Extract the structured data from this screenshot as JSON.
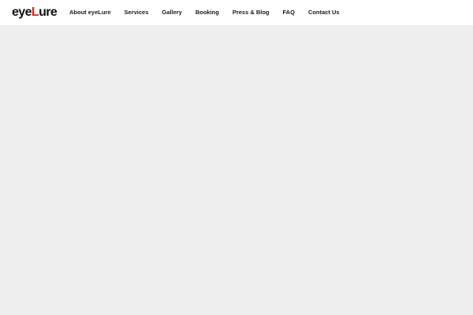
{
  "brand": {
    "logo_part1": "eye",
    "logo_accent": "L",
    "logo_part2": "ure",
    "accent_color": "#d7262c"
  },
  "nav": {
    "items": [
      {
        "label": "About eyeLure"
      },
      {
        "label": "Services"
      },
      {
        "label": "Gallery"
      },
      {
        "label": "Booking"
      },
      {
        "label": "Press & Blog"
      },
      {
        "label": "FAQ"
      },
      {
        "label": "Contact Us"
      }
    ]
  },
  "colors": {
    "header_bg": "#ffffff",
    "page_bg": "#eeeeee",
    "nav_text": "#1a1a1a"
  }
}
